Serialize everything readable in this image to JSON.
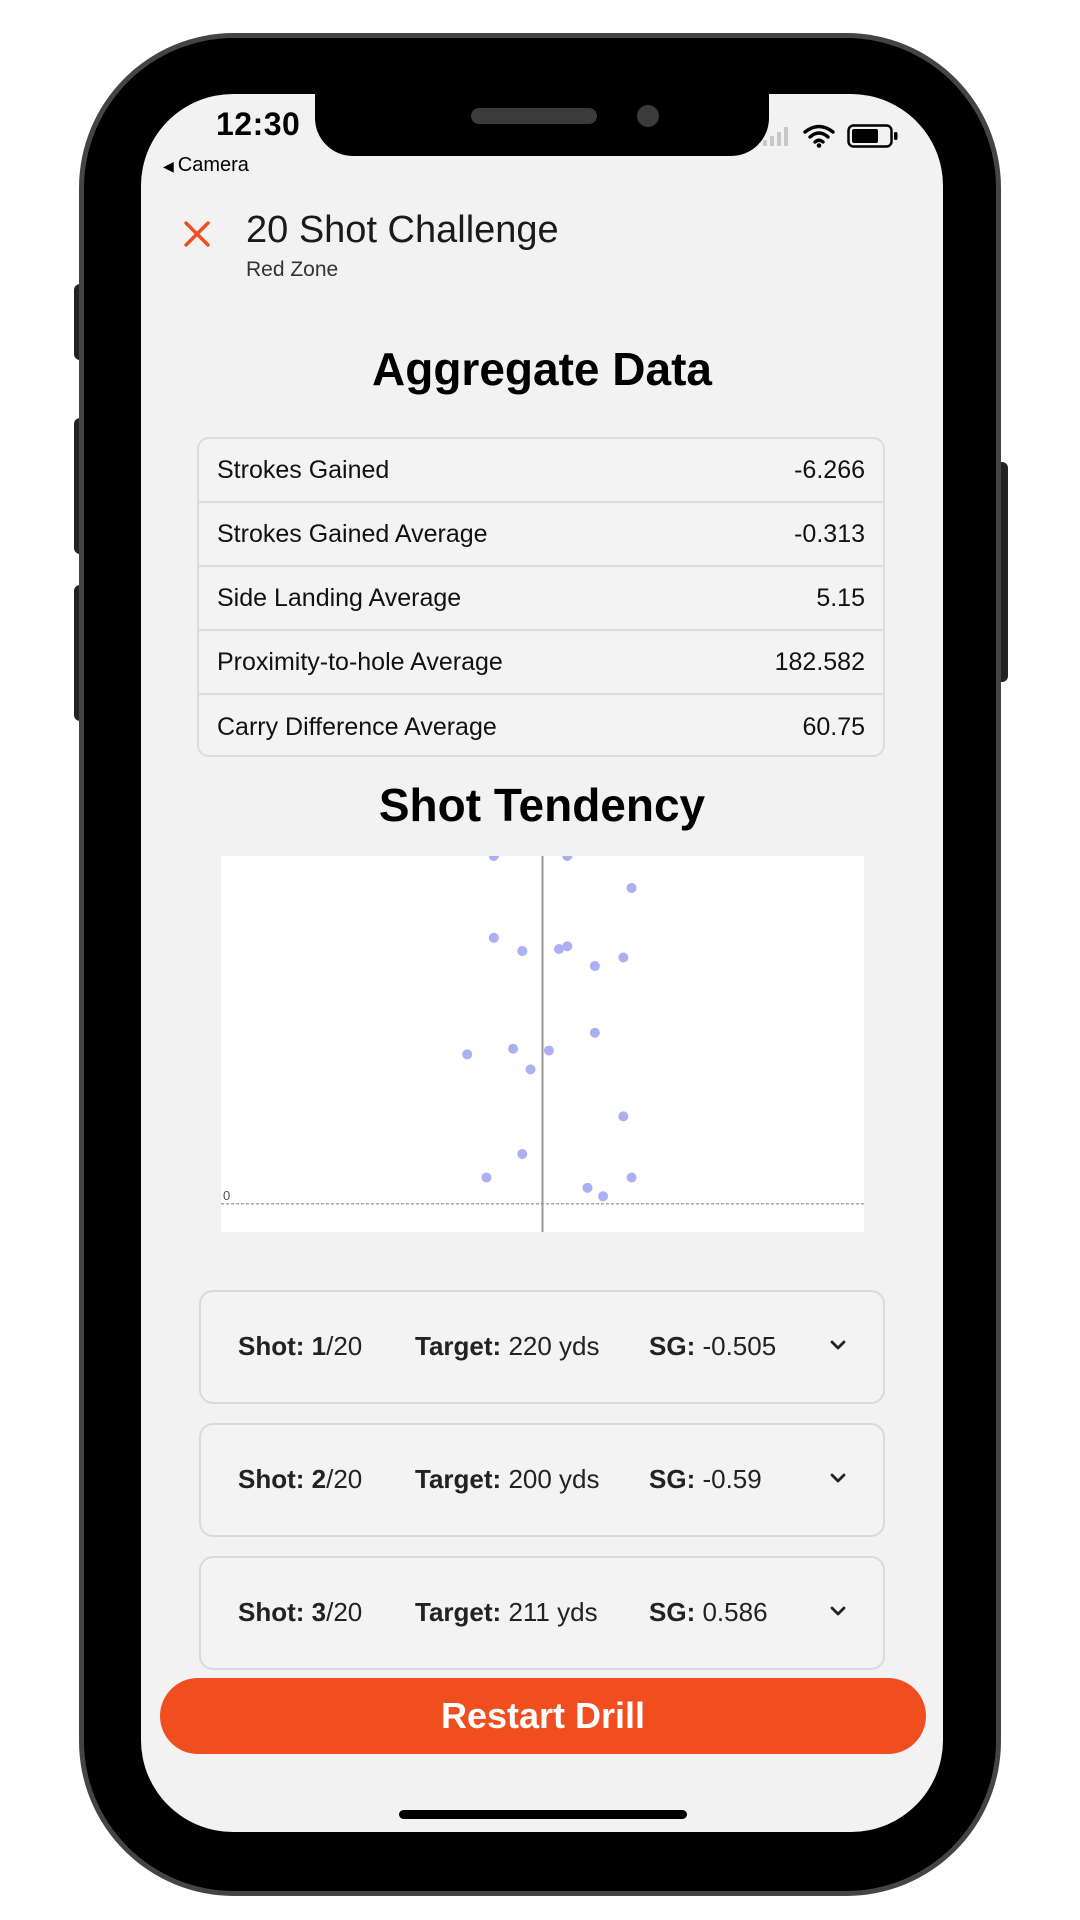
{
  "status_bar": {
    "time": "12:30",
    "back_app": "Camera"
  },
  "header": {
    "title": "20 Shot Challenge",
    "subtitle": "Red Zone"
  },
  "aggregate": {
    "title": "Aggregate Data",
    "rows": [
      {
        "label": "Strokes Gained",
        "value": "-6.266"
      },
      {
        "label": "Strokes Gained Average",
        "value": "-0.313"
      },
      {
        "label": "Side Landing Average",
        "value": "5.15"
      },
      {
        "label": "Proximity-to-hole Average",
        "value": "182.582"
      },
      {
        "label": "Carry Difference Average",
        "value": "60.75"
      }
    ]
  },
  "tendency": {
    "title": "Shot Tendency"
  },
  "chart_data": {
    "type": "scatter",
    "title": "Shot Tendency",
    "xlabel": "",
    "ylabel": "",
    "y_tick_labels": [
      "0"
    ],
    "xlim": [
      -35,
      35
    ],
    "ylim": [
      -3,
      37
    ],
    "center_line_x": 0,
    "zero_line_y": 0,
    "point_color": "#aab0f2",
    "points": [
      {
        "x": -5.3,
        "y": 37.0
      },
      {
        "x": 2.7,
        "y": 37.0
      },
      {
        "x": 9.7,
        "y": 33.6
      },
      {
        "x": -5.3,
        "y": 28.3
      },
      {
        "x": -2.2,
        "y": 26.9
      },
      {
        "x": 1.8,
        "y": 27.1
      },
      {
        "x": 2.7,
        "y": 27.4
      },
      {
        "x": 8.8,
        "y": 26.2
      },
      {
        "x": 5.7,
        "y": 25.3
      },
      {
        "x": 5.7,
        "y": 18.2
      },
      {
        "x": -3.2,
        "y": 16.5
      },
      {
        "x": 0.7,
        "y": 16.3
      },
      {
        "x": -8.2,
        "y": 15.9
      },
      {
        "x": -1.3,
        "y": 14.3
      },
      {
        "x": 8.8,
        "y": 9.3
      },
      {
        "x": -2.2,
        "y": 5.3
      },
      {
        "x": -6.1,
        "y": 2.8
      },
      {
        "x": 9.7,
        "y": 2.8
      },
      {
        "x": 4.9,
        "y": 1.7
      },
      {
        "x": 6.6,
        "y": 0.8
      }
    ]
  },
  "shots": [
    {
      "shot_label": "Shot:",
      "shot_num": "1",
      "shot_total": "/20",
      "target_label": "Target:",
      "target": "220 yds",
      "sg_label": "SG:",
      "sg": "-0.505"
    },
    {
      "shot_label": "Shot:",
      "shot_num": "2",
      "shot_total": "/20",
      "target_label": "Target:",
      "target": "200 yds",
      "sg_label": "SG:",
      "sg": "-0.59"
    },
    {
      "shot_label": "Shot:",
      "shot_num": "3",
      "shot_total": "/20",
      "target_label": "Target:",
      "target": "211 yds",
      "sg_label": "SG:",
      "sg": "0.586"
    }
  ],
  "restart_button": {
    "label": "Restart Drill"
  },
  "colors": {
    "accent": "#f04e1f",
    "background": "#f2f2f2"
  }
}
